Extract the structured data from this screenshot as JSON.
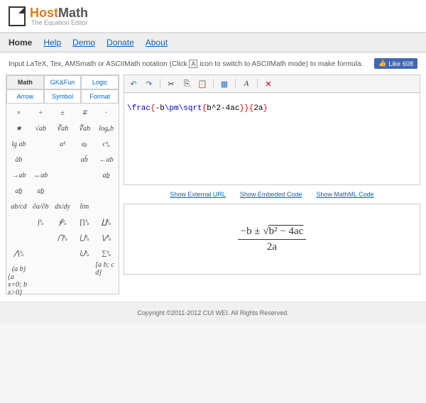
{
  "brand": {
    "part1": "Host",
    "part2": "Math",
    "tagline": "The Equation Editor"
  },
  "nav": {
    "home": "Home",
    "help": "Help",
    "demo": "Demo",
    "donate": "Donate",
    "about": "About"
  },
  "instruction": {
    "text_before": "Input LaTeX, Tex, AMSmath or ASCIIMath notation (Click ",
    "ascii_icon": "A",
    "text_after": " icon to switch to ASCIIMath mode) to make formula."
  },
  "like": {
    "label": "Like",
    "count": "608"
  },
  "palette": {
    "tabs": [
      "Math",
      "GK&Fun",
      "Logic",
      "Arrow",
      "Symbol",
      "Format"
    ],
    "active_tab": "Math",
    "cells": [
      "×",
      "÷",
      "±",
      "∓",
      "·",
      "★",
      "√ab",
      "∛ab",
      "∜ab",
      "logₐb",
      "lg ab",
      "",
      "aᵇ",
      "aᵦ",
      "cᵇₐ",
      "ãb",
      "",
      "",
      "ab̄",
      "←ab",
      "→ab",
      "↔ab",
      "",
      "",
      "ab̲",
      "ab̲",
      "ab̲",
      "",
      "",
      "",
      "ab/cd",
      "∂a/∂b",
      "dx/dy",
      "lim",
      "",
      "",
      "∫ᵇₐ",
      "∮ᵇₐ",
      "∏ᵇₐ",
      "∐ᵇₐ",
      "",
      "",
      "⋂ᵇₐ",
      "⋃ᵇₐ",
      "⋁ᵇₐ",
      "⋀ᵇₐ",
      "",
      "",
      "⨃ᵇₐ",
      "∑ᵇₐ",
      "(a b)",
      "",
      "",
      "",
      "[a b; c d]",
      "{a x=0; b x>0}",
      "",
      "",
      "",
      ""
    ]
  },
  "toolbar": {
    "undo": "↶",
    "redo": "↷",
    "cut": "✂",
    "copy": "⎘",
    "paste": "📋",
    "mode": "▦",
    "font": "A",
    "clear": "✕"
  },
  "input": {
    "frac": "\\frac",
    "b1o": "{",
    "neg": "-b",
    "pm": "\\pm",
    "sqrt": "\\sqrt",
    "b2o": "{",
    "inside": "b^2-4ac",
    "b2c": "}",
    "b1c": "}",
    "b3o": "{",
    "den": "2a",
    "b3c": "}"
  },
  "links": {
    "ext": "Show External URL",
    "embed": "Show Embeded Code",
    "mathml": "Show MathML Code"
  },
  "output": {
    "numerator_pre": "−b ± ",
    "sqrt_sym": "√",
    "under_sqrt": "b² − 4ac",
    "denominator": "2a"
  },
  "footer": "Copyright ©2011-2012 CUI WEI. All Rights Reserved."
}
